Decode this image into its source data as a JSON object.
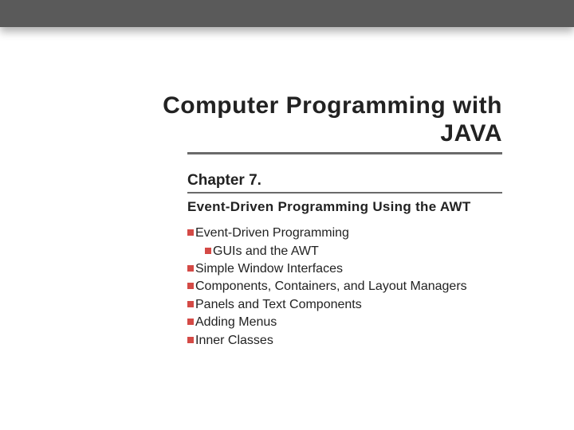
{
  "title_line1": "Computer Programming with",
  "title_line2": "JAVA",
  "chapter": {
    "label": "Chapter 7.",
    "subtitle": "Event-Driven Programming Using the AWT"
  },
  "topics": [
    {
      "text": "Event-Driven Programming",
      "level": 0
    },
    {
      "text": "GUIs and the AWT",
      "level": 1
    },
    {
      "text": "Simple Window Interfaces",
      "level": 0
    },
    {
      "text": "Components, Containers, and Layout Managers",
      "level": 0
    },
    {
      "text": "Panels and Text Components",
      "level": 0
    },
    {
      "text": "Adding Menus",
      "level": 0
    },
    {
      "text": "Inner Classes",
      "level": 0
    }
  ]
}
